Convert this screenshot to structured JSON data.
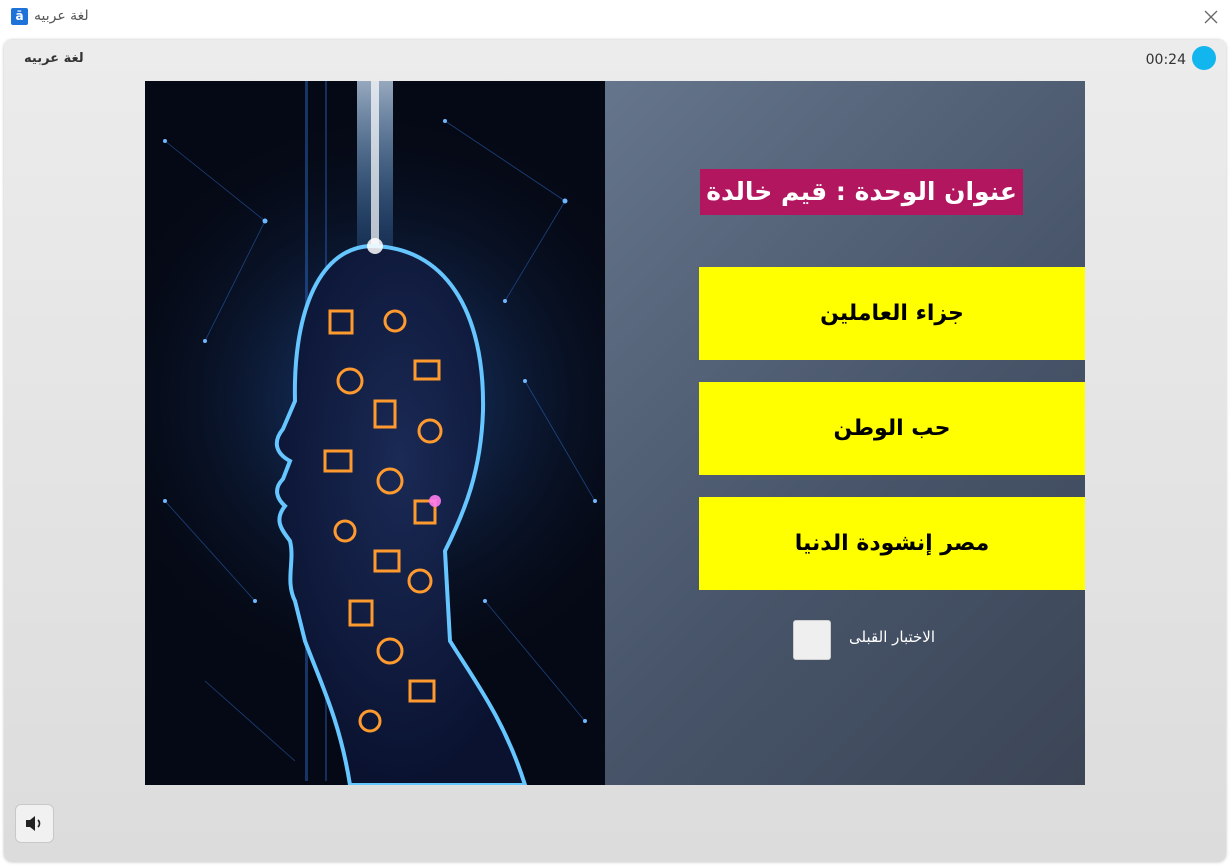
{
  "window": {
    "title": "لغة عربيه",
    "app_icon_glyph": "ā",
    "close_icon": "close-icon"
  },
  "header": {
    "title": "لغة عربيه",
    "timer": "00:24",
    "timer_color": "#12b6ee"
  },
  "slide": {
    "image": "digital-head-illustration",
    "unit_title": "عنوان الوحدة : قيم خالدة",
    "unit_title_bg": "#b2165f",
    "lessons": [
      {
        "label": "جزاء العاملين"
      },
      {
        "label": "حب الوطن"
      },
      {
        "label": "مصر إنشودة الدنيا"
      }
    ],
    "lesson_bg": "#ffff00",
    "pretest_label": "الاختبار القبلى"
  },
  "footer": {
    "audio_icon": "speaker-icon"
  }
}
